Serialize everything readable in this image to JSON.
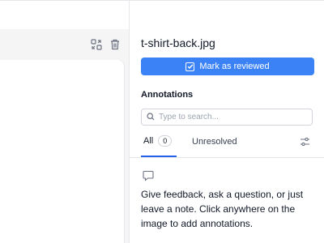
{
  "file": {
    "name": "t-shirt-back.jpg"
  },
  "review_button": {
    "label": "Mark as reviewed"
  },
  "annotations": {
    "title": "Annotations",
    "search_placeholder": "Type to search...",
    "tabs": [
      {
        "label": "All",
        "count": "0",
        "active": true
      },
      {
        "label": "Unresolved",
        "active": false
      }
    ],
    "empty_message": "Give feedback, ask a question, or just leave a note. Click anywhere on the image to add annotations."
  },
  "toolbar": {
    "icons": [
      "compare-icon",
      "trash-icon"
    ]
  },
  "colors": {
    "accent": "#3b82f6",
    "tab_underline": "#2563eb",
    "border": "#e5e7eb"
  }
}
